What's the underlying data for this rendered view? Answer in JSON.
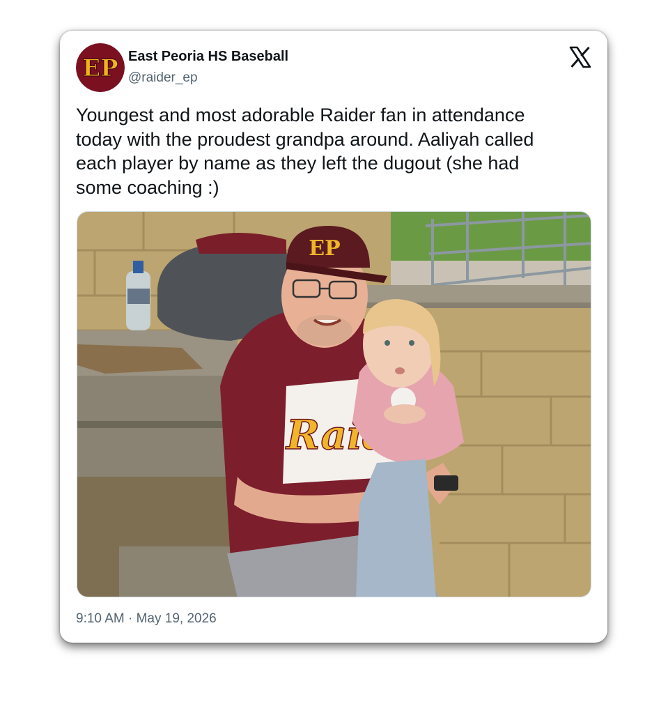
{
  "account": {
    "display_name": "East Peoria HS Baseball",
    "handle": "@raider_ep",
    "avatar_initials": "EP",
    "avatar_colors": {
      "background": "#7a1020",
      "letters": "#f2b21c"
    }
  },
  "platform_icon": "x-logo-icon",
  "tweet": {
    "text_lines": [
      "Youngest and most adorable Raider fan in attendance",
      "today with the proudest grandpa around. Aaliyah called",
      "each player by name as they left the dugout (she had",
      "some coaching :)"
    ],
    "timestamp": "9:10 AM · May 19, 2026"
  },
  "photo": {
    "cap_logo": "EP",
    "jersey_text": "Raid"
  }
}
